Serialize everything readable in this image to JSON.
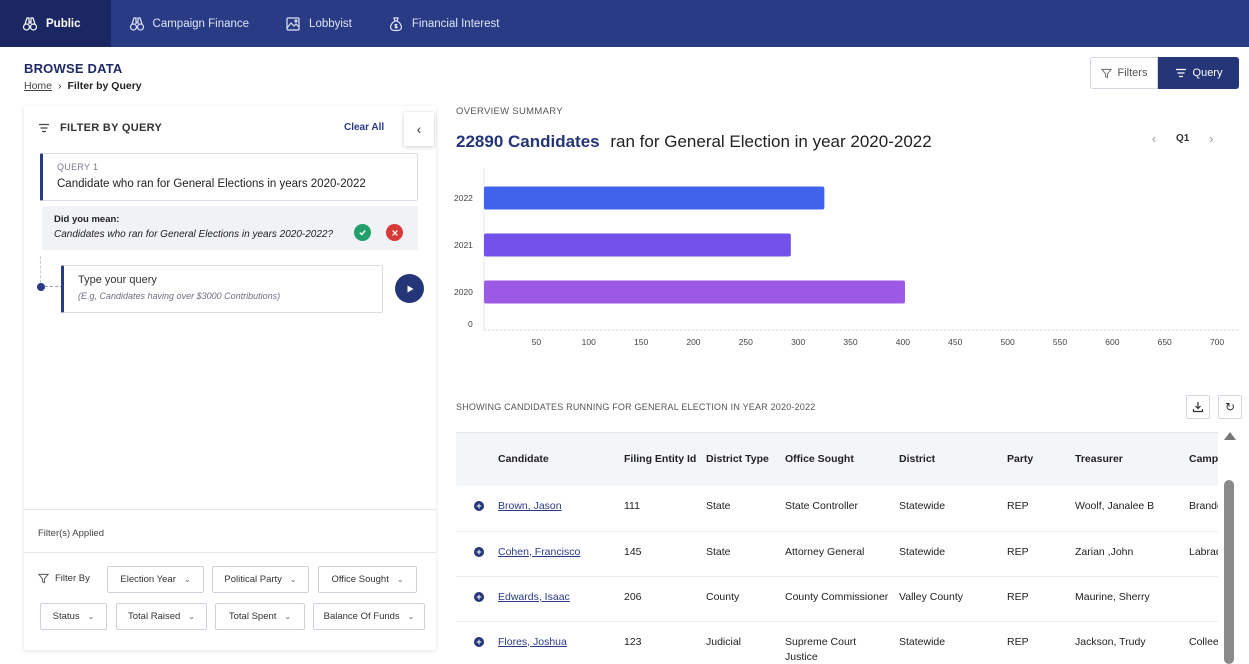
{
  "nav": {
    "items": [
      {
        "label": "Public",
        "icon": "binoculars-icon"
      },
      {
        "label": "Campaign Finance",
        "icon": "binoculars-icon"
      },
      {
        "label": "Lobbyist",
        "icon": "image-icon"
      },
      {
        "label": "Financial Interest",
        "icon": "money-bag-icon"
      }
    ]
  },
  "header": {
    "title": "BROWSE DATA",
    "breadcrumb_home": "Home",
    "breadcrumb_current": "Filter by Query",
    "filters_label": "Filters",
    "query_label": "Query"
  },
  "query_panel": {
    "title": "FILTER BY QUERY",
    "clear_all": "Clear All",
    "query_label": "QUERY 1",
    "query_text": "Candidate who ran for General Elections in years 2020-2022",
    "suggest_label": "Did you mean:",
    "suggest_text": "Candidates who ran for General Elections in years 2020-2022?",
    "input_placeholder": "Type your query",
    "input_hint": "(E.g, Candidates having over $3000 Contributions)",
    "filters_applied": "Filter(s) Applied",
    "filter_by": "Filter By",
    "filter_chips": [
      "Election Year",
      "Political Party",
      "Office Sought",
      "Status",
      "Total Raised",
      "Total Spent",
      "Balance Of Funds"
    ]
  },
  "overview": {
    "label": "OVERVIEW SUMMARY",
    "count": "22890 Candidates",
    "title_rest": "ran for General Election in year 2020-2022",
    "quarter": "Q1"
  },
  "chart_data": {
    "type": "bar",
    "orientation": "horizontal",
    "categories": [
      "2022",
      "2021",
      "2020"
    ],
    "values": [
      325,
      293,
      402
    ],
    "colors": [
      "#3f63ea",
      "#7251ea",
      "#9b59e6"
    ],
    "y_zero_label": "0",
    "x_ticks": [
      50,
      100,
      150,
      200,
      250,
      300,
      350,
      400,
      450,
      500,
      550,
      600,
      650,
      700
    ],
    "xlim": [
      0,
      720
    ]
  },
  "table": {
    "caption": "SHOWING CANDIDATES RUNNING FOR GENERAL ELECTION IN YEAR 2020-2022",
    "headers": [
      "Candidate",
      "Filing Entity Id",
      "District Type",
      "Office Sought",
      "District",
      "Party",
      "Treasurer",
      "Campaign"
    ],
    "rows": [
      [
        "Brown, Jason",
        "111",
        "State",
        "State Controller",
        "Statewide",
        "REP",
        "Woolf, Janalee B",
        "Brandon State C"
      ],
      [
        "Cohen, Francisco",
        "145",
        "State",
        "Attorney General",
        "Statewide",
        "REP",
        "Zarian ,John",
        "Labrador"
      ],
      [
        "Edwards, Isaac",
        "206",
        "County",
        "County Commissioner",
        "Valley County",
        "REP",
        "Maurine, Sherry",
        ""
      ],
      [
        "Flores, Joshua",
        "123",
        "Judicial",
        "Supreme Court Justice",
        "Statewide",
        "REP",
        "Jackson, Trudy",
        "Colleen"
      ]
    ]
  },
  "colors": {
    "nav_bg": "#2a3b86",
    "nav_active": "#1b2762",
    "accent": "#243677"
  }
}
